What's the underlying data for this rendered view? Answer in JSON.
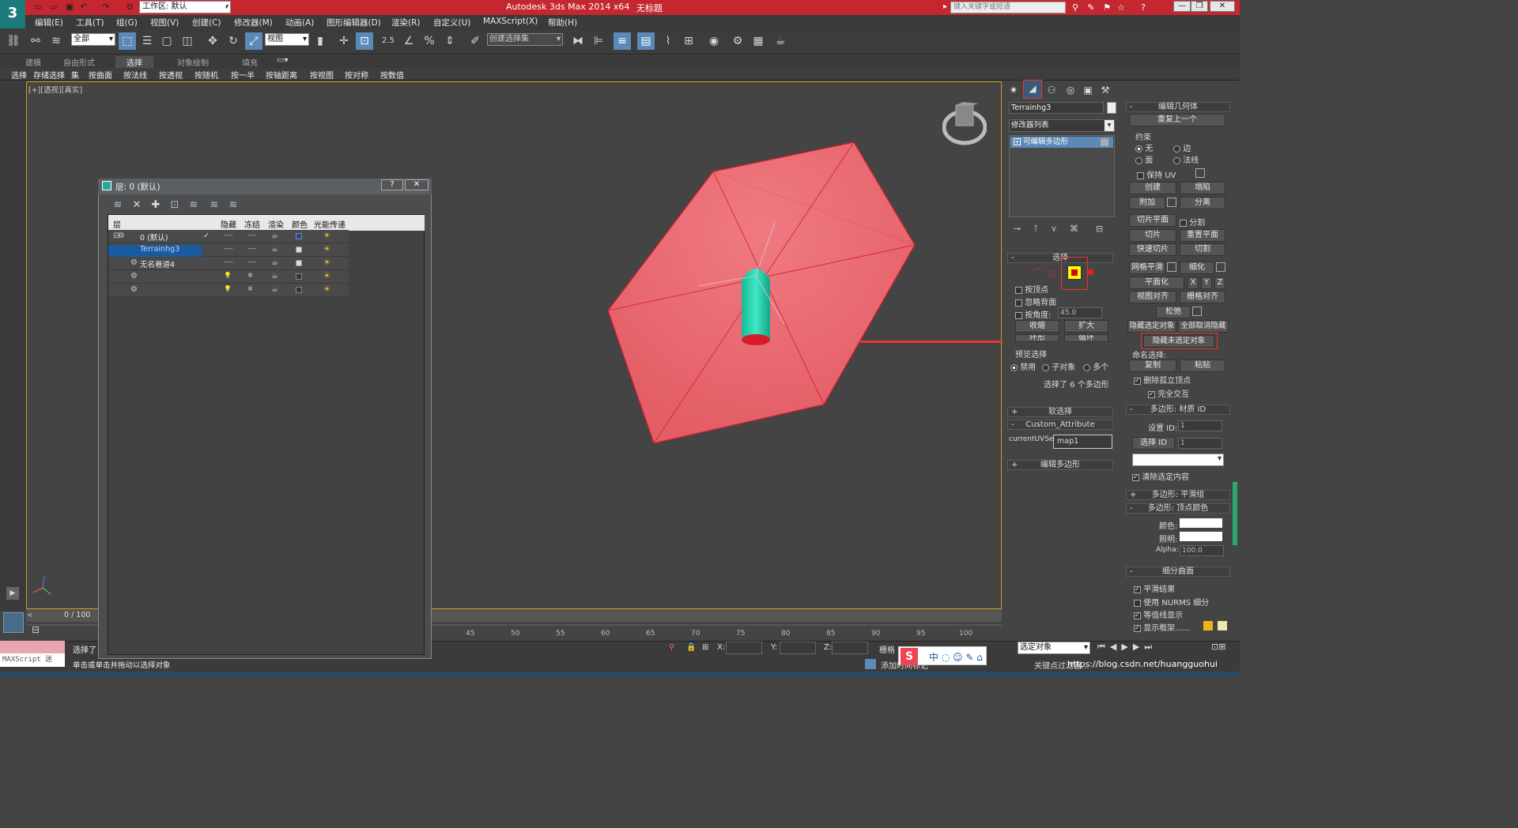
{
  "app": {
    "title": "Autodesk 3ds Max  2014 x64",
    "file": "无标题",
    "workspace": "工作区: 默认",
    "search_placeholder": "键入关键字或短语",
    "logo_text": "3"
  },
  "menu": [
    "编辑(E)",
    "工具(T)",
    "组(G)",
    "视图(V)",
    "创建(C)",
    "修改器(M)",
    "动画(A)",
    "图形编辑器(D)",
    "渲染(R)",
    "自定义(U)",
    "MAXScript(X)",
    "帮助(H)"
  ],
  "toolbar": {
    "filter": "全部",
    "ref_coord": "视图",
    "snap_value": "2.5",
    "named_sel": "创建选择集"
  },
  "ribbon_tabs": [
    "建模",
    "自由形式",
    "选择",
    "对象绘制",
    "填充"
  ],
  "ribbon_active": "选择",
  "ribbon_items": [
    "选择",
    "存储选择",
    "集",
    "按曲面",
    "按法线",
    "按透视",
    "按随机",
    "按一半",
    "按轴距离",
    "按视图",
    "按对称",
    "按数值"
  ],
  "viewport": {
    "label": "[+][透视][真实]",
    "plane_color": "#e8676e",
    "obj_color": "#1fc7a4"
  },
  "layer_window": {
    "title": "层: 0 (默认)",
    "help_btn": "?",
    "close_btn": "✕",
    "columns": [
      "层",
      "隐藏",
      "冻结",
      "渲染",
      "颜色",
      "光能传递"
    ],
    "rows": [
      {
        "name": "0 (默认)",
        "hide": "----",
        "freeze": "----",
        "color": "#1a4aa8",
        "check": "✓",
        "selected": false
      },
      {
        "name": "Terrainhg3",
        "hide": "----",
        "freeze": "----",
        "color": "#dddddd",
        "check": "",
        "selected": true
      },
      {
        "name": "无名巷道4",
        "hide": "----",
        "freeze": "----",
        "color": "#dddddd",
        "check": "",
        "selected": false
      },
      {
        "name": "",
        "hide": "💡",
        "freeze": "✲",
        "color": "#333333",
        "check": "",
        "selected": false
      },
      {
        "name": "",
        "hide": "💡",
        "freeze": "✲",
        "color": "#333333",
        "check": "",
        "selected": false
      }
    ]
  },
  "command_panel": {
    "object_name": "Terrainhg3",
    "modifier_list": "修改器列表",
    "stack_item": "可编辑多边形",
    "selection": {
      "header": "选择",
      "by_vertex": "按顶点",
      "ignore_back": "忽略背面",
      "by_angle": "按角度:",
      "angle_value": "45.0",
      "shrink": "收缩",
      "grow": "扩大",
      "ring": "环形",
      "loop": "循环",
      "preview_label": "预览选择",
      "preview_options": [
        "禁用",
        "子对象",
        "多个"
      ],
      "status": "选择了 6 个多边形"
    },
    "soft_sel": "软选择",
    "custom_attr": "Custom_Attribute",
    "uvset_label": "currentUVSet",
    "uvset_value": "map1",
    "edit_poly": "编辑多边形",
    "edit_geom": {
      "header": "编辑几何体",
      "repeat": "重复上一个",
      "constraint": "约束",
      "c_none": "无",
      "c_edge": "边",
      "c_face": "面",
      "c_normal": "法线",
      "keep_uv": "保持 UV",
      "create": "创建",
      "collapse": "塌陷",
      "attach": "附加",
      "detach": "分离",
      "slice_plane": "切片平面",
      "split": "分割",
      "slice": "切片",
      "reset_plane": "重置平面",
      "quickslice": "快速切片",
      "cut": "切割",
      "meshsmooth": "网格平滑",
      "tessellate": "细化",
      "planarize": "平面化",
      "x": "X",
      "y": "Y",
      "z": "Z",
      "view_align": "视图对齐",
      "grid_align": "栅格对齐",
      "relax": "松弛",
      "hide_sel": "隐藏选定对象",
      "unhide_all": "全部取消隐藏",
      "hide_unsel": "隐藏未选定对象",
      "named_sel": "命名选择:",
      "copy": "复制",
      "paste": "粘贴",
      "del_iso": "删除孤立顶点",
      "full_inter": "完全交互"
    },
    "mat_id": {
      "header": "多边形: 材质 ID",
      "set_id": "设置 ID:",
      "select_id": "选择 ID",
      "set_val": "1",
      "sel_val": "1",
      "clear_sel": "清除选定内容"
    },
    "smooth_group": "多边形: 平滑组",
    "vertex_color": {
      "header": "多边形: 顶点颜色",
      "color": "颜色:",
      "illum": "照明:",
      "alpha": "Alpha:",
      "alpha_val": "100.0"
    },
    "subdiv": {
      "header": "细分曲面",
      "smooth_result": "平滑结果",
      "use_nurms": "使用 NURMS 细分",
      "isoline": "等值线显示",
      "show_cage": "显示框架......"
    }
  },
  "timeline": {
    "frame": "0 / 100",
    "ticks": [
      "45",
      "50",
      "55",
      "60",
      "65",
      "70",
      "75",
      "80",
      "85",
      "90",
      "95",
      "100"
    ]
  },
  "status": {
    "maxscript": "MAXScript 迷",
    "line1": "选择了",
    "line2": "单击或单击并拖动以选择对象",
    "x_label": "X:",
    "y_label": "Y:",
    "z_label": "Z:",
    "grid_label": "栅格",
    "key_filter": "选定对象",
    "add_time_tag": "添加时间标记",
    "key_filter2": "关键点过滤器...",
    "watermark": "https://blog.csdn.net/huangguohui"
  }
}
